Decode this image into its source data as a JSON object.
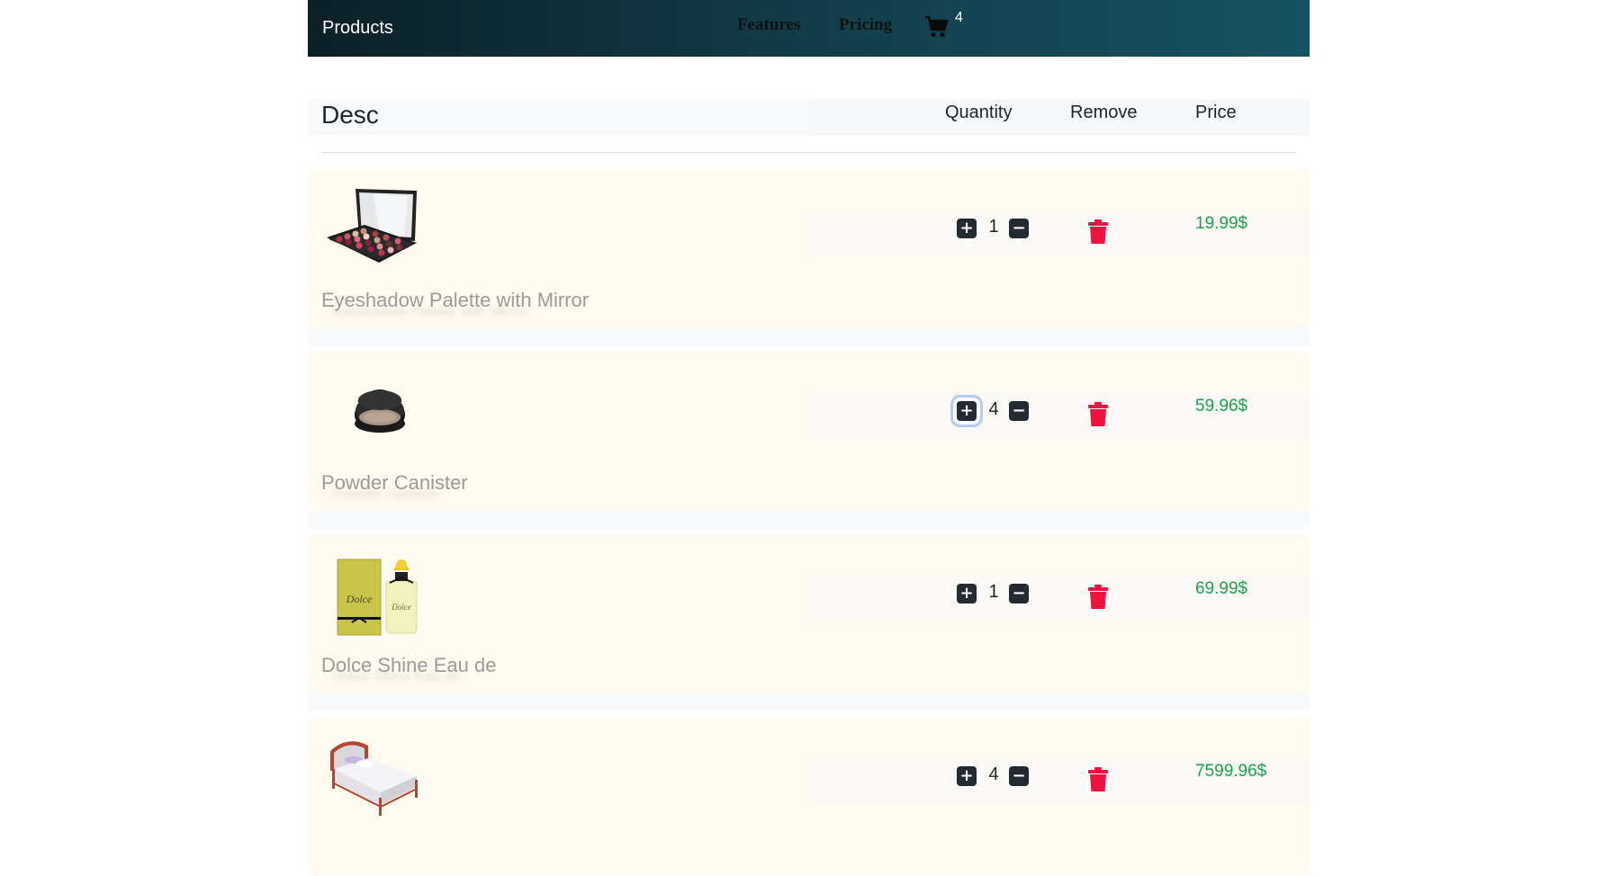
{
  "navbar": {
    "brand": "Products",
    "links": [
      "Features",
      "Pricing"
    ],
    "cart_count": "4",
    "cart_icon": "shopping-cart-icon"
  },
  "table_header": {
    "desc": "Desc",
    "quantity": "Quantity",
    "remove": "Remove",
    "price": "Price"
  },
  "items": [
    {
      "name": "Eyeshadow Palette with Mirror",
      "quantity": "1",
      "price": "19.99$",
      "image": "eyeshadow-palette"
    },
    {
      "name": "Powder Canister",
      "quantity": "4",
      "price": "59.96$",
      "image": "powder-compact"
    },
    {
      "name": "Dolce Shine Eau de",
      "quantity": "1",
      "price": "69.99$",
      "image": "perfume-box-bottle"
    },
    {
      "name": "",
      "quantity": "4",
      "price": "7599.96$",
      "image": "bed"
    }
  ],
  "controls": {
    "plus": "+",
    "minus": "−"
  },
  "colors": {
    "navbar_start": "#0b2026",
    "navbar_end": "#165264",
    "price": "#1aa34a",
    "trash": "#f0123e",
    "card_bg": "#fffbf0",
    "button_bg": "#232a31"
  }
}
